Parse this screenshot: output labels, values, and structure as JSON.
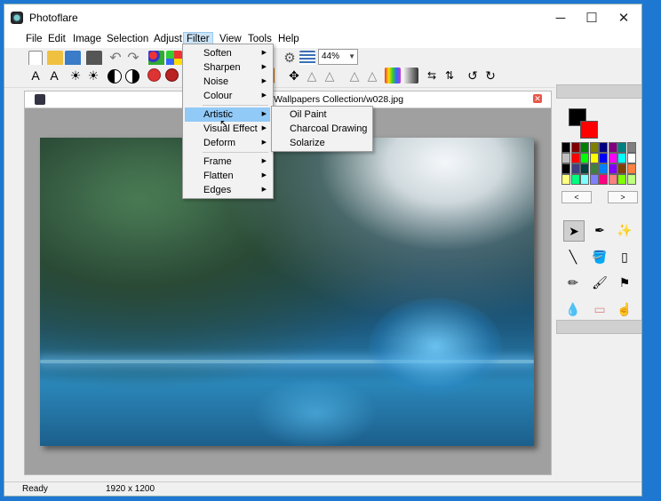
{
  "window": {
    "title": "Photoflare",
    "minimize": "─",
    "maximize": "☐",
    "close": "✕"
  },
  "menu": [
    "File",
    "Edit",
    "Image",
    "Selection",
    "Adjust",
    "Filter",
    "View",
    "Tools",
    "Help"
  ],
  "toolbar": {
    "zoom": "44%"
  },
  "document": {
    "title": "Wallpapers Collection/w028.jpg",
    "close": "✕"
  },
  "filter_menu": {
    "items": [
      "Soften",
      "Sharpen",
      "Noise",
      "Colour",
      "Artistic",
      "Visual Effect",
      "Deform",
      "Frame",
      "Flatten",
      "Edges"
    ],
    "highlighted": "Artistic"
  },
  "artistic_submenu": [
    "Oil Paint",
    "Charcoal Drawing",
    "Solarize"
  ],
  "palette": {
    "prev": "<",
    "next": ">",
    "colors": [
      "#000000",
      "#800000",
      "#008000",
      "#808000",
      "#000080",
      "#800080",
      "#008080",
      "#808080",
      "#c0c0c0",
      "#ff0000",
      "#00ff00",
      "#ffff00",
      "#0000ff",
      "#ff00ff",
      "#00ffff",
      "#ffffff",
      "#000000",
      "#404080",
      "#004040",
      "#408040",
      "#0080ff",
      "#8000ff",
      "#804000",
      "#ff8040",
      "#ffff80",
      "#00ff80",
      "#80ffff",
      "#8080ff",
      "#ff0080",
      "#ff8080",
      "#80ff00",
      "#c0ff80"
    ],
    "foreground": "#000000",
    "background": "#ff0000"
  },
  "status": {
    "left": "Ready",
    "size": "1920 x 1200"
  }
}
